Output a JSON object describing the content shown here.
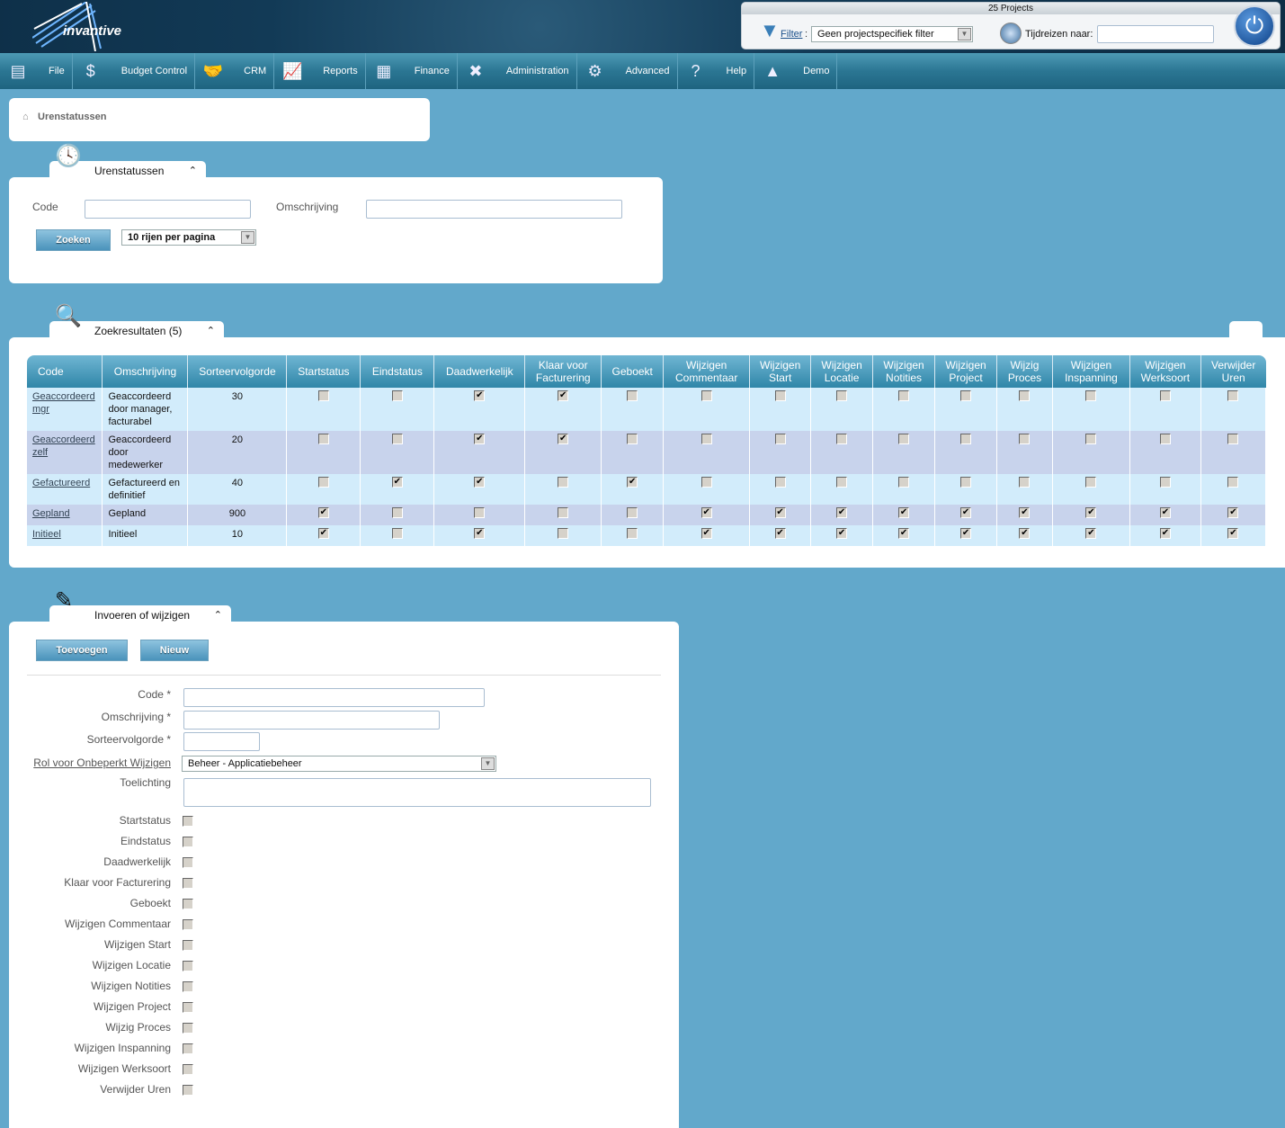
{
  "header": {
    "logo": "invantive",
    "projects": "25 Projects",
    "filter_label": "Filter",
    "filter_value": "Geen projectspecifiek filter",
    "timetravel_label": "Tijdreizen naar:",
    "timetravel_value": ""
  },
  "nav": [
    {
      "label": "File",
      "icon": "cabinet-icon",
      "glyph": "▤"
    },
    {
      "label": "Budget Control",
      "icon": "money-bag-icon",
      "glyph": "$"
    },
    {
      "label": "CRM",
      "icon": "handshake-icon",
      "glyph": "🤝"
    },
    {
      "label": "Reports",
      "icon": "presentation-icon",
      "glyph": "📈"
    },
    {
      "label": "Finance",
      "icon": "calculator-icon",
      "glyph": "▦"
    },
    {
      "label": "Administration",
      "icon": "tools-icon",
      "glyph": "✖"
    },
    {
      "label": "Advanced",
      "icon": "gears-icon",
      "glyph": "⚙"
    },
    {
      "label": "Help",
      "icon": "help-icon",
      "glyph": "?"
    },
    {
      "label": "Demo",
      "icon": "demo-icon",
      "glyph": "▲"
    }
  ],
  "breadcrumb": "Urenstatussen",
  "search": {
    "title": "Urenstatussen",
    "code_label": "Code",
    "omschrijving_label": "Omschrijving",
    "search_button": "Zoeken",
    "rows_per_page": "10 rijen per pagina"
  },
  "results": {
    "title": "Zoekresultaten (5)",
    "columns": [
      "Code",
      "Omschrijving",
      "Sorteervolgorde",
      "Startstatus",
      "Eindstatus",
      "Daadwerkelijk",
      "Klaar voor Facturering",
      "Geboekt",
      "Wijzigen Commentaar",
      "Wijzigen Start",
      "Wijzigen Locatie",
      "Wijzigen Notities",
      "Wijzigen Project",
      "Wijzig Proces",
      "Wijzigen Inspanning",
      "Wijzigen Werksoort",
      "Verwijder Uren"
    ],
    "rows": [
      {
        "code": "Geaccordeerd mgr",
        "omschrijving": "Geaccordeerd door manager, facturabel",
        "sort": "30",
        "checks": [
          false,
          false,
          true,
          true,
          false,
          false,
          false,
          false,
          false,
          false,
          false,
          false,
          false,
          false
        ]
      },
      {
        "code": "Geaccordeerd zelf",
        "omschrijving": "Geaccordeerd door medewerker",
        "sort": "20",
        "checks": [
          false,
          false,
          true,
          true,
          false,
          false,
          false,
          false,
          false,
          false,
          false,
          false,
          false,
          false
        ]
      },
      {
        "code": "Gefactureerd",
        "omschrijving": "Gefactureerd en definitief",
        "sort": "40",
        "checks": [
          false,
          true,
          true,
          false,
          true,
          false,
          false,
          false,
          false,
          false,
          false,
          false,
          false,
          false
        ]
      },
      {
        "code": "Gepland",
        "omschrijving": "Gepland",
        "sort": "900",
        "checks": [
          true,
          false,
          false,
          false,
          false,
          true,
          true,
          true,
          true,
          true,
          true,
          true,
          true,
          true
        ]
      },
      {
        "code": "Initieel",
        "omschrijving": "Initieel",
        "sort": "10",
        "checks": [
          true,
          false,
          true,
          false,
          false,
          true,
          true,
          true,
          true,
          true,
          true,
          true,
          true,
          true
        ]
      }
    ]
  },
  "edit": {
    "title": "Invoeren of wijzigen",
    "add_button": "Toevoegen",
    "new_button": "Nieuw",
    "code_label": "Code *",
    "omschrijving_label": "Omschrijving *",
    "sort_label": "Sorteervolgorde *",
    "role_label": "Rol voor Onbeperkt Wijzigen",
    "role_value": "Beheer - Applicatiebeheer",
    "toelichting_label": "Toelichting",
    "checkboxes": [
      {
        "label": "Startstatus",
        "checked": false
      },
      {
        "label": "Eindstatus",
        "checked": false
      },
      {
        "label": "Daadwerkelijk",
        "checked": false
      },
      {
        "label": "Klaar voor Facturering",
        "checked": false
      },
      {
        "label": "Geboekt",
        "checked": false
      },
      {
        "label": "Wijzigen Commentaar",
        "checked": false
      },
      {
        "label": "Wijzigen Start",
        "checked": false
      },
      {
        "label": "Wijzigen Locatie",
        "checked": false
      },
      {
        "label": "Wijzigen Notities",
        "checked": false
      },
      {
        "label": "Wijzigen Project",
        "checked": false
      },
      {
        "label": "Wijzig Proces",
        "checked": false
      },
      {
        "label": "Wijzigen Inspanning",
        "checked": false
      },
      {
        "label": "Wijzigen Werksoort",
        "checked": false
      },
      {
        "label": "Verwijder Uren",
        "checked": false
      }
    ]
  }
}
